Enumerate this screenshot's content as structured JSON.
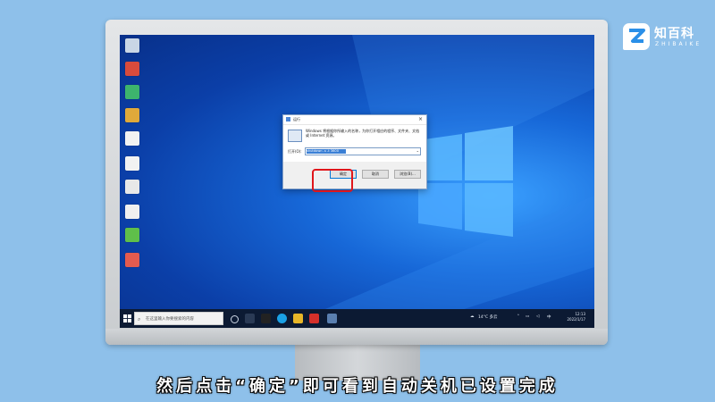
{
  "logo": {
    "name": "知百科",
    "sub": "ZHIBAIKE"
  },
  "caption": "然后点击“确定”即可看到自动关机已设置完成",
  "dialog": {
    "title": "运行",
    "description": "Windows 将根据你所输入的名称，为你打开相应的程序、文件夹、文档或 Internet 资源。",
    "open_label": "打开(O):",
    "open_value": "shutdown -s -t 3600",
    "ok_label": "确定",
    "cancel_label": "取消",
    "browse_label": "浏览(B)..."
  },
  "taskbar": {
    "search_placeholder": "在这里输入你要搜索的内容",
    "weather": "14°C 多云",
    "time": "12:13",
    "date": "2022/1/17"
  },
  "colors": {
    "highlight": "#e0161b",
    "accent": "#0078d7",
    "background": "#8fbfe9"
  }
}
